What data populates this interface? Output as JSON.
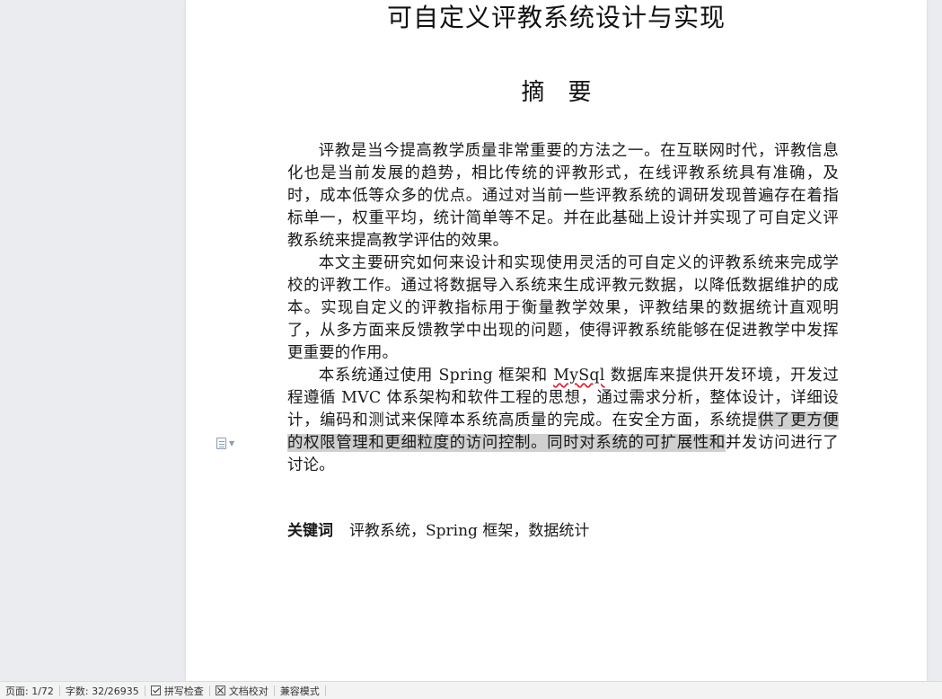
{
  "document": {
    "title": "可自定义评教系统设计与实现",
    "abstract_heading": "摘　要",
    "paragraphs": [
      {
        "text": "评教是当今提高教学质量非常重要的方法之一。在互联网时代，评教信息化也是当前发展的趋势，相比传统的评教形式，在线评教系统具有准确，及时，成本低等众多的优点。通过对当前一些评教系统的调研发现普遍存在着指标单一，权重平均，统计简单等不足。并在此基础上设计并实现了可自定义评教系统来提高教学评估的效果。"
      },
      {
        "text": "本文主要研究如何来设计和实现使用灵活的可自定义的评教系统来完成学校的评教工作。通过将数据导入系统来生成评教元数据，以降低数据维护的成本。实现自定义的评教指标用于衡量教学效果，评教结果的数据统计直观明了，从多方面来反馈教学中出现的问题，使得评教系统能够在促进教学中发挥更重要的作用。"
      },
      {
        "text_a": "本系统通过使用 Spring 框架和 ",
        "spell_error_word": "MySql",
        "text_b": " 数据库来提供开发环境，开发过程遵循 MVC 体系架构和软件工程的思想，通过需求分析，整体设计，详细设计，编码和测试来保障本系统高质量的完成。在安全方面，系统提",
        "highlighted": "供了更方便的权限管理和更细粒度的访问控制。同时对系统的可扩展性和",
        "text_c": "并发访问进行了讨论。"
      }
    ],
    "keywords_label": "关键词",
    "keywords": "评教系统，Spring 框架，数据统计"
  },
  "status_bar": {
    "page": "页面: 1/72",
    "word_count": "字数: 32/26935",
    "spell_check": "拼写检查",
    "doc_proofread": "文档校对",
    "compat_mode": "兼容模式"
  },
  "icons": {
    "paragraph_marker": "document-icon",
    "spell_check": "checkbox-checked-icon",
    "doc_proofread": "checkbox-cross-icon"
  }
}
